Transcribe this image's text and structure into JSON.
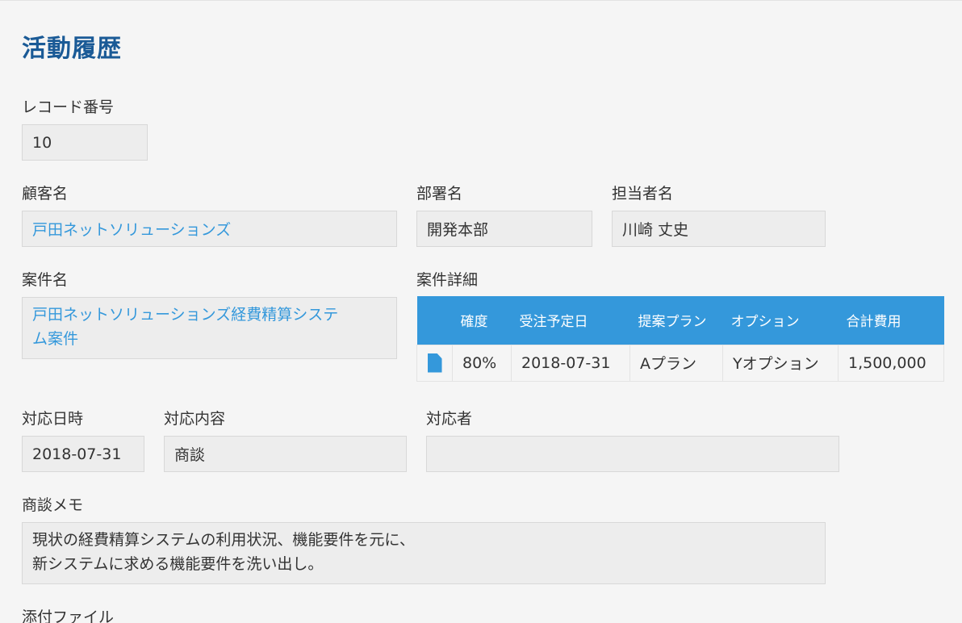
{
  "page_title": "活動履歴",
  "record_number": {
    "label": "レコード番号",
    "value": "10"
  },
  "customer": {
    "label": "顧客名",
    "value": "戸田ネットソリューションズ"
  },
  "department": {
    "label": "部署名",
    "value": "開発本部"
  },
  "person": {
    "label": "担当者名",
    "value": "川崎 丈史"
  },
  "project": {
    "label": "案件名",
    "value_line1": "戸田ネットソリューションズ経費精算システ",
    "value_line2": "ム案件"
  },
  "project_detail": {
    "label": "案件詳細",
    "headers": [
      "確度",
      "受注予定日",
      "提案プラン",
      "オプション",
      "合計費用"
    ],
    "rows": [
      {
        "icon": "document-icon",
        "probability": "80%",
        "order_date": "2018-07-31",
        "plan": "Aプラン",
        "option": "Yオプション",
        "total": "1,500,000"
      }
    ]
  },
  "response_date": {
    "label": "対応日時",
    "value": "2018-07-31"
  },
  "response_content": {
    "label": "対応内容",
    "value": "商談"
  },
  "responder": {
    "label": "対応者",
    "value": ""
  },
  "memo": {
    "label": "商談メモ",
    "line1": "現状の経費精算システムの利用状況、機能要件を元に、",
    "line2": "新システムに求める機能要件を洗い出し。"
  },
  "attachment": {
    "label": "添付ファイル"
  },
  "colors": {
    "title": "#1a5a96",
    "link": "#3498db",
    "table_header": "#3498db",
    "field_bg": "#ededed",
    "page_bg": "#f5f5f5"
  }
}
